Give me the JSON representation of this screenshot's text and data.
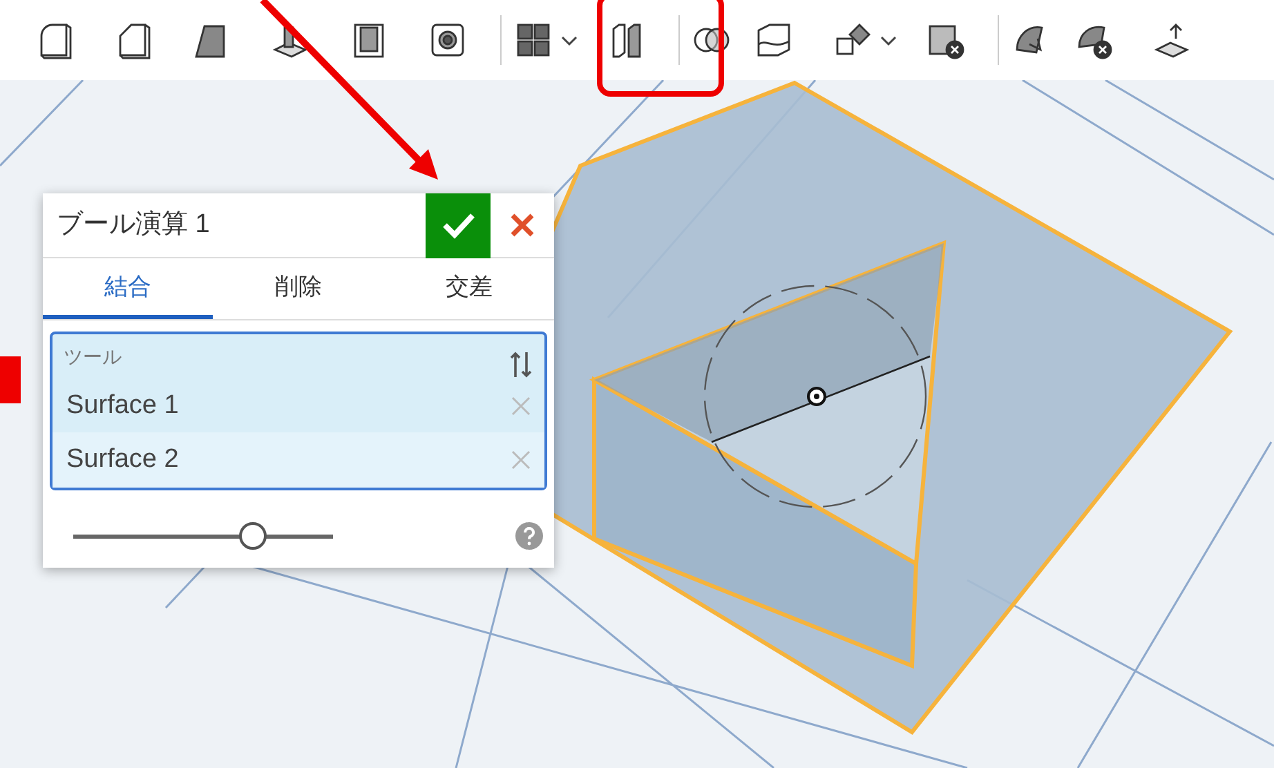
{
  "dialog": {
    "title": "ブール演算 1",
    "tabs": [
      {
        "label": "結合",
        "selected": true
      },
      {
        "label": "削除",
        "selected": false
      },
      {
        "label": "交差",
        "selected": false
      }
    ],
    "tools": {
      "label": "ツール",
      "items": [
        "Surface 1",
        "Surface 2"
      ]
    },
    "slider": {
      "level": 0.69
    }
  }
}
